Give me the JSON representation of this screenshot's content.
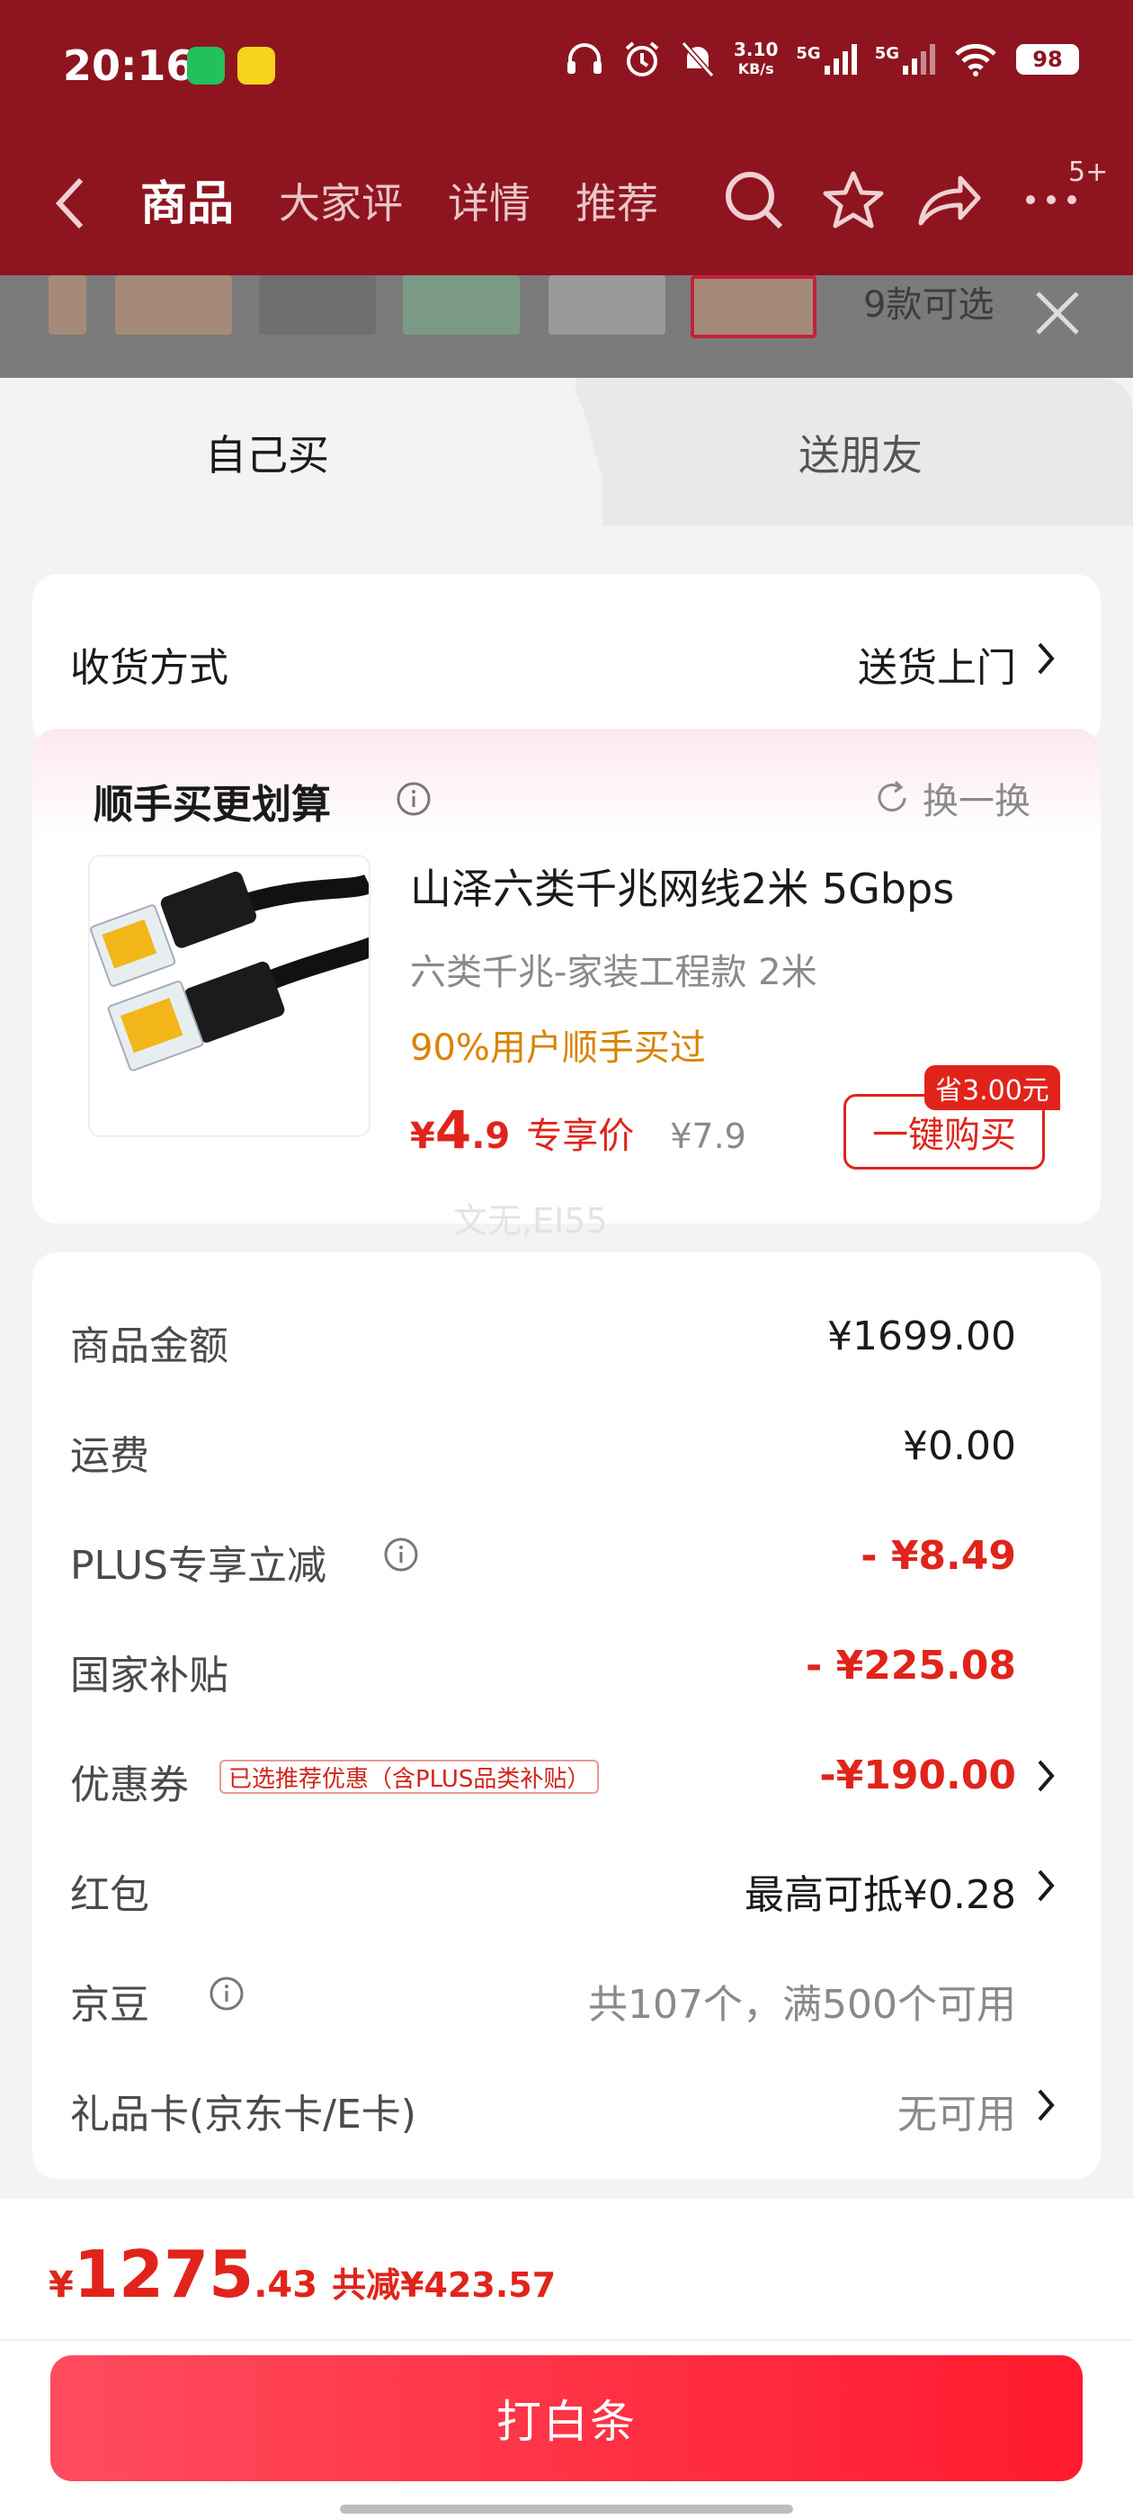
{
  "status_bar": {
    "time": "20:16",
    "net_speed": "3.10",
    "net_unit": "KB/s",
    "sim1": "5G",
    "sim2": "5G",
    "battery": "98"
  },
  "nav": {
    "tabs": [
      "商品",
      "大家评",
      "详情",
      "推荐"
    ],
    "active_tab": "商品",
    "more_badge": "5+"
  },
  "thumbs_strip": {
    "more_text": "9款可选"
  },
  "sheet_tabs": {
    "self": "自己买",
    "friend": "送朋友"
  },
  "delivery": {
    "label": "收货方式",
    "value": "送货上门"
  },
  "addon": {
    "title": "顺手买更划算",
    "refresh": "换一换",
    "product_name": "山泽六类千兆网线2米 5Gbps",
    "spec": "六类千兆-家装工程款   2米",
    "rate": "90%用户顺手买过",
    "price_symbol": "¥",
    "price_int": "4",
    "price_dec": ".9",
    "price_tag": "专享价",
    "old_price": "¥7.9",
    "save_tag": "省3.00元",
    "buy_button": "一键购买"
  },
  "watermark": "文无,EI55",
  "summary": {
    "goods_amount_label": "商品金额",
    "goods_amount": "¥1699.00",
    "shipping_label": "运费",
    "shipping": "¥0.00",
    "plus_label": "PLUS专享立减",
    "plus": "- ¥8.49",
    "subsidy_label": "国家补贴",
    "subsidy": "- ¥225.08",
    "coupon_label": "优惠券",
    "coupon_tag": "已选推荐优惠（含PLUS品类补贴）",
    "coupon": "-¥190.00",
    "redpacket_label": "红包",
    "redpacket": "最高可抵¥0.28",
    "jingdou_label": "京豆",
    "jingdou": "共107个，满500个可用",
    "giftcard_label": "礼品卡(京东卡/E卡)",
    "giftcard": "无可用"
  },
  "footer": {
    "symbol": "¥",
    "total_int": "1275",
    "total_dec": ".43",
    "saved": "共减¥423.57",
    "pay_button": "打白条"
  },
  "colors": {
    "header_red": "#8e1520",
    "accent_red": "#e0241b",
    "orange": "#d98300"
  }
}
